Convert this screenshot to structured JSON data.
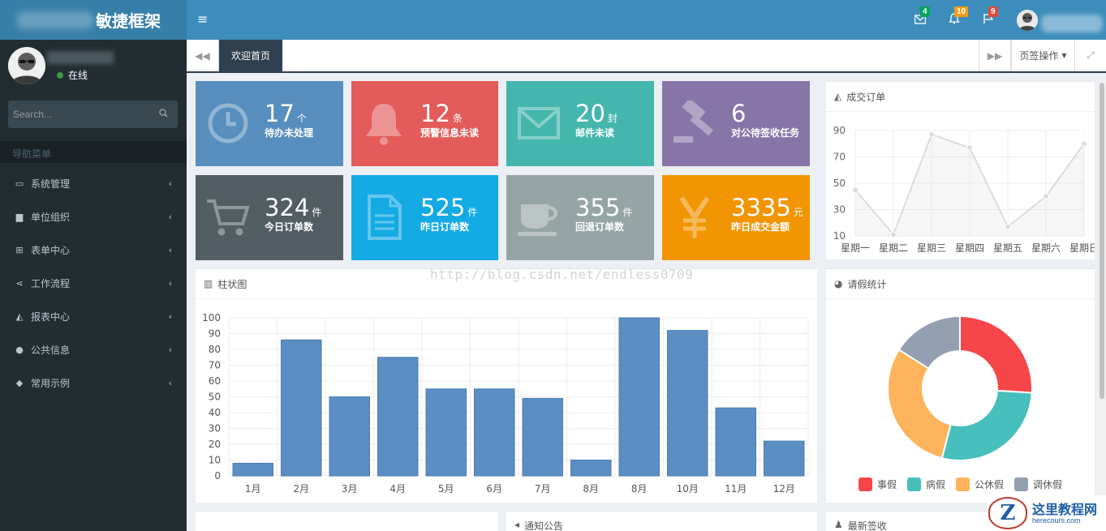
{
  "app": {
    "title": "敏捷框架"
  },
  "topbar": {
    "toggle_icon": "bars-icon",
    "notifications": [
      {
        "icon": "envelope-icon",
        "count": "4",
        "color": "#00a65a"
      },
      {
        "icon": "bell-icon",
        "count": "10",
        "color": "#f39c12"
      },
      {
        "icon": "flag-icon",
        "count": "9",
        "color": "#dd4b39"
      }
    ]
  },
  "sidebar": {
    "status": "在线",
    "search_placeholder": "Search...",
    "nav_header": "导航菜单",
    "items": [
      {
        "label": "系统管理",
        "icon": "desktop-icon"
      },
      {
        "label": "单位组织",
        "icon": "cubes-icon"
      },
      {
        "label": "表单中心",
        "icon": "table-icon"
      },
      {
        "label": "工作流程",
        "icon": "share-alt-icon"
      },
      {
        "label": "报表中心",
        "icon": "area-chart-icon"
      },
      {
        "label": "公共信息",
        "icon": "globe-icon"
      },
      {
        "label": "常用示例",
        "icon": "tags-icon"
      }
    ]
  },
  "tabs": {
    "active": "欢迎首页",
    "operations": "页签操作"
  },
  "tiles": [
    {
      "num": "17",
      "unit": "个",
      "label": "待办未处理",
      "color": "#578ebe",
      "icon": "clock-icon"
    },
    {
      "num": "12",
      "unit": "条",
      "label": "预警信息未读",
      "color": "#e35b5a",
      "icon": "bell-icon"
    },
    {
      "num": "20",
      "unit": "封",
      "label": "邮件未读",
      "color": "#44b6ae",
      "icon": "envelope-icon"
    },
    {
      "num": "6",
      "unit": "",
      "label": "对公待签收任务",
      "color": "#8775a7",
      "icon": "gavel-icon"
    },
    {
      "num": "324",
      "unit": "件",
      "label": "今日订单数",
      "color": "#525e64",
      "icon": "shopping-cart-icon"
    },
    {
      "num": "525",
      "unit": "件",
      "label": "昨日订单数",
      "color": "#14aae4",
      "icon": "file-text-icon"
    },
    {
      "num": "355",
      "unit": "件",
      "label": "回退订单数",
      "color": "#95a5a6",
      "icon": "coffee-icon"
    },
    {
      "num": "3335",
      "unit": "元",
      "label": "昨日成交金额",
      "color": "#f29503",
      "icon": "yen-icon"
    }
  ],
  "panels": {
    "line_title": "成交订单",
    "bar_title": "柱状图",
    "pie_title": "请假统计",
    "bottom_mid_title": "通知公告",
    "bottom_right_title": "最新签收"
  },
  "watermark": "http://blog.csdn.net/endless0709",
  "brand": {
    "mark": "Z",
    "title": "这里教程网",
    "url": "herecours.com"
  },
  "chart_data": [
    {
      "type": "line",
      "title": "成交订单",
      "categories": [
        "星期一",
        "星期二",
        "星期三",
        "星期四",
        "星期五",
        "星期六",
        "星期日"
      ],
      "values": [
        45,
        11,
        87,
        77,
        17,
        40,
        80
      ],
      "yticks": [
        10,
        30,
        50,
        70,
        90
      ],
      "ylim": [
        10,
        90
      ],
      "grid": true,
      "color": "#dcdcdc"
    },
    {
      "type": "bar",
      "title": "柱状图",
      "categories": [
        "1月",
        "2月",
        "3月",
        "4月",
        "5月",
        "6月",
        "7月",
        "8月",
        "8月",
        "10月",
        "11月",
        "12月"
      ],
      "values": [
        8,
        86,
        50,
        75,
        55,
        55,
        49,
        10,
        100,
        92,
        43,
        22
      ],
      "yticks": [
        0,
        10,
        20,
        30,
        40,
        50,
        60,
        70,
        80,
        90,
        100
      ],
      "ylim": [
        0,
        100
      ],
      "grid": true,
      "color": "#5b8ec3"
    },
    {
      "type": "pie",
      "title": "请假统计",
      "labels": [
        "事假",
        "病假",
        "公休假",
        "调休假"
      ],
      "values": [
        26,
        28,
        30,
        16
      ],
      "colors": [
        "#f7464a",
        "#46bfbd",
        "#fdb45c",
        "#949fb1"
      ],
      "legend": "bottom"
    }
  ]
}
